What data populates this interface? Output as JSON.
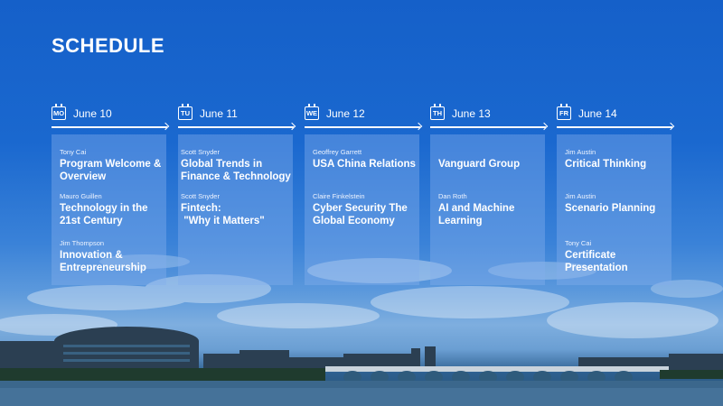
{
  "title": "SCHEDULE",
  "days": [
    {
      "abbr": "MO",
      "date": "June 10",
      "sessions": [
        {
          "speaker": "Tony Cai",
          "topic_lines": [
            "Program Welcome &",
            "Overview"
          ]
        },
        {
          "speaker": "Mauro Guillen",
          "topic_lines": [
            "Technology in the",
            "21st Century"
          ]
        },
        {
          "speaker": "Jim Thompson",
          "topic_lines": [
            "Innovation &",
            "Entrepreneurship"
          ]
        }
      ]
    },
    {
      "abbr": "TU",
      "date": "June 11",
      "sessions": [
        {
          "speaker": "Scott Snyder",
          "topic_lines": [
            "Global Trends in",
            "Finance & Technology"
          ]
        },
        {
          "speaker": "Scott Snyder",
          "topic_lines": [
            "Fintech:",
            " \"Why it Matters\""
          ]
        }
      ]
    },
    {
      "abbr": "WE",
      "date": "June 12",
      "sessions": [
        {
          "speaker": "Geoffrey Garrett",
          "topic_lines": [
            "USA China Relations"
          ]
        },
        {
          "speaker": "Claire Finkelstein",
          "topic_lines": [
            "Cyber Security The",
            "Global Economy"
          ]
        }
      ]
    },
    {
      "abbr": "TH",
      "date": "June 13",
      "sessions": [
        {
          "speaker": "",
          "topic_lines": [
            "Vanguard Group"
          ]
        },
        {
          "speaker": "Dan Roth",
          "topic_lines": [
            "AI and Machine",
            "Learning"
          ]
        }
      ]
    },
    {
      "abbr": "FR",
      "date": "June 14",
      "sessions": [
        {
          "speaker": "Jim Austin",
          "topic_lines": [
            "Critical Thinking"
          ]
        },
        {
          "speaker": "Jim Austin",
          "topic_lines": [
            "Scenario Planning"
          ]
        },
        {
          "speaker": "Tony Cai",
          "topic_lines": [
            "Certificate",
            "Presentation"
          ]
        }
      ]
    }
  ]
}
